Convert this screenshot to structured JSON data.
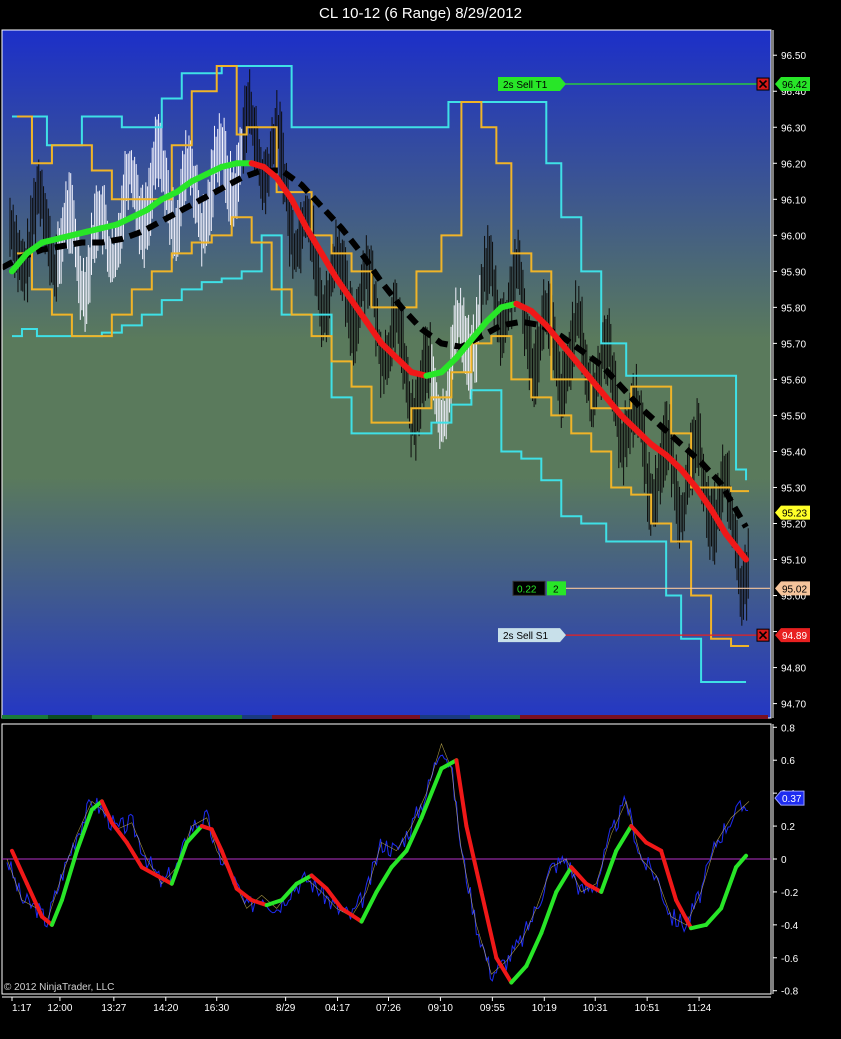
{
  "window": {
    "title": "CL 10-12 (6 Range)  8/29/2012"
  },
  "copyright": "© 2012 NinjaTrader, LLC",
  "colors": {
    "bg_top": "#1c2fc9",
    "bg_mid": "#5a7a5c",
    "bg_bottom": "#2437c4",
    "frame": "#ffffff",
    "cyan_band": "#3fe0e6",
    "orange_band": "#f0b428",
    "trend_up": "#28e628",
    "trend_down": "#f01818",
    "baseline": "#000000",
    "osc_fast": "#1e2cf0",
    "osc_zero": "#b432c8"
  },
  "chart_data": [
    {
      "type": "line",
      "panel": "price",
      "y_ticks": [
        "96.50",
        "96.40",
        "96.30",
        "96.20",
        "96.10",
        "96.00",
        "95.90",
        "95.80",
        "95.70",
        "95.60",
        "95.50",
        "95.40",
        "95.30",
        "95.20",
        "95.10",
        "95.00",
        "94.90",
        "94.80",
        "94.70"
      ],
      "ylim": [
        94.66,
        96.57
      ],
      "x_range": [
        0,
        770
      ],
      "price_markers": [
        {
          "label": "96.42",
          "value": 96.42,
          "color": "#28e628",
          "text_color": "#000000"
        },
        {
          "label": "95.23",
          "value": 95.23,
          "color": "#ffff28",
          "text_color": "#000000"
        },
        {
          "label": "95.02",
          "value": 95.02,
          "color": "#f5c49b",
          "text_color": "#000000"
        },
        {
          "label": "94.89",
          "value": 94.89,
          "color": "#e82020",
          "text_color": "#ffffff"
        }
      ],
      "order_lines": [
        {
          "label": "2s   Sell T1",
          "value": 96.42,
          "color": "#28e628",
          "text_color": "#000000"
        },
        {
          "label": "2s   Sell S1",
          "value": 94.89,
          "color": "#c8e0ea",
          "text_color": "#000000",
          "line_color": "#e82020"
        }
      ],
      "position": {
        "pnl": "0.22",
        "qty": "2",
        "value": 95.02
      },
      "series": [
        {
          "name": "",
          "role": "trend",
          "width": 6,
          "color_switch": true,
          "x": [
            10,
            25,
            40,
            55,
            70,
            85,
            100,
            115,
            130,
            145,
            160,
            175,
            190,
            205,
            220,
            235,
            250,
            262,
            275,
            290,
            305,
            320,
            335,
            350,
            365,
            380,
            395,
            410,
            425,
            440,
            455,
            470,
            485,
            500,
            515,
            530,
            545,
            560,
            575,
            590,
            605,
            620,
            635,
            650,
            665,
            680,
            695,
            710,
            725,
            745
          ],
          "y": [
            95.9,
            95.95,
            95.98,
            95.99,
            96.0,
            96.01,
            96.02,
            96.03,
            96.05,
            96.07,
            96.1,
            96.12,
            96.15,
            96.17,
            96.19,
            96.2,
            96.2,
            96.19,
            96.16,
            96.1,
            96.02,
            95.95,
            95.88,
            95.82,
            95.76,
            95.7,
            95.66,
            95.62,
            95.61,
            95.62,
            95.66,
            95.71,
            95.76,
            95.8,
            95.81,
            95.79,
            95.75,
            95.7,
            95.65,
            95.6,
            95.55,
            95.5,
            95.46,
            95.42,
            95.39,
            95.35,
            95.3,
            95.24,
            95.17,
            95.1
          ]
        },
        {
          "name": "",
          "role": "baseline",
          "width": 6,
          "dash": "12,7",
          "x": [
            0,
            20,
            40,
            60,
            80,
            100,
            120,
            140,
            160,
            180,
            200,
            220,
            240,
            260,
            280,
            300,
            320,
            340,
            360,
            380,
            400,
            420,
            440,
            460,
            480,
            500,
            520,
            540,
            560,
            580,
            600,
            620,
            640,
            660,
            680,
            700,
            720,
            745
          ],
          "y": [
            95.91,
            95.94,
            95.96,
            95.97,
            95.98,
            95.98,
            95.99,
            96.01,
            96.04,
            96.07,
            96.1,
            96.13,
            96.16,
            96.18,
            96.18,
            96.14,
            96.08,
            96.02,
            95.95,
            95.87,
            95.8,
            95.74,
            95.7,
            95.69,
            95.72,
            95.75,
            95.76,
            95.75,
            95.72,
            95.68,
            95.64,
            95.58,
            95.52,
            95.47,
            95.42,
            95.37,
            95.31,
            95.19
          ]
        },
        {
          "name": "",
          "role": "cyan_upper",
          "width": 2,
          "step": true,
          "x": [
            10,
            30,
            45,
            60,
            80,
            100,
            120,
            140,
            160,
            180,
            200,
            220,
            240,
            260,
            290,
            310,
            330,
            360,
            390,
            420,
            447,
            470,
            490,
            510,
            530,
            545,
            560,
            580,
            600,
            625,
            650,
            670,
            690,
            712,
            735,
            745
          ],
          "y": [
            96.33,
            96.33,
            96.25,
            96.25,
            96.33,
            96.33,
            96.3,
            96.3,
            96.38,
            96.45,
            96.45,
            96.47,
            96.47,
            96.47,
            96.3,
            96.3,
            96.3,
            96.3,
            96.3,
            96.3,
            96.37,
            96.37,
            96.37,
            96.37,
            96.37,
            96.2,
            96.05,
            95.9,
            95.7,
            95.61,
            95.61,
            95.61,
            95.61,
            95.61,
            95.35,
            95.32
          ]
        },
        {
          "name": "",
          "role": "cyan_lower",
          "width": 2,
          "step": true,
          "x": [
            10,
            20,
            35,
            60,
            80,
            100,
            120,
            140,
            160,
            180,
            200,
            220,
            240,
            260,
            280,
            300,
            330,
            350,
            370,
            390,
            410,
            430,
            450,
            470,
            490,
            500,
            520,
            540,
            560,
            580,
            605,
            640,
            665,
            680,
            700,
            720,
            745
          ],
          "y": [
            95.72,
            95.74,
            95.72,
            95.72,
            95.72,
            95.73,
            95.75,
            95.78,
            95.82,
            95.85,
            95.87,
            95.88,
            95.9,
            96.0,
            95.78,
            95.78,
            95.55,
            95.45,
            95.45,
            95.45,
            95.45,
            95.48,
            95.53,
            95.57,
            95.57,
            95.4,
            95.38,
            95.32,
            95.22,
            95.2,
            95.15,
            95.15,
            95.0,
            94.88,
            94.76,
            94.76,
            94.76
          ]
        },
        {
          "name": "",
          "role": "orange_upper",
          "width": 2,
          "step": true,
          "x": [
            15,
            30,
            50,
            70,
            90,
            110,
            130,
            150,
            170,
            190,
            215,
            235,
            245,
            275,
            290,
            310,
            330,
            350,
            370,
            390,
            415,
            440,
            460,
            480,
            495,
            510,
            530,
            550,
            570,
            590,
            610,
            630,
            650,
            670,
            690,
            710,
            730,
            748
          ],
          "y": [
            96.33,
            96.2,
            96.25,
            96.25,
            96.18,
            96.1,
            96.1,
            96.1,
            96.25,
            96.4,
            96.47,
            96.28,
            96.3,
            96.12,
            96.12,
            96.0,
            95.95,
            95.9,
            95.8,
            95.8,
            95.9,
            96.0,
            96.37,
            96.3,
            96.2,
            95.95,
            95.9,
            95.6,
            95.6,
            95.52,
            95.52,
            95.58,
            95.58,
            95.45,
            95.3,
            95.3,
            95.29,
            95.29
          ]
        },
        {
          "name": "",
          "role": "orange_lower",
          "width": 2,
          "step": true,
          "x": [
            15,
            30,
            50,
            70,
            90,
            110,
            130,
            150,
            170,
            190,
            210,
            230,
            250,
            270,
            290,
            310,
            330,
            350,
            370,
            390,
            410,
            430,
            450,
            470,
            490,
            510,
            530,
            550,
            570,
            590,
            610,
            630,
            650,
            670,
            690,
            710,
            730,
            748
          ],
          "y": [
            95.95,
            95.85,
            95.78,
            95.72,
            95.72,
            95.78,
            95.85,
            95.9,
            95.95,
            95.98,
            96.0,
            96.05,
            95.98,
            95.85,
            95.78,
            95.72,
            95.65,
            95.58,
            95.48,
            95.48,
            95.52,
            95.55,
            95.62,
            95.7,
            95.72,
            95.6,
            95.55,
            95.5,
            95.45,
            95.4,
            95.3,
            95.28,
            95.2,
            95.15,
            95.0,
            94.88,
            94.86,
            94.86
          ]
        }
      ]
    },
    {
      "type": "line",
      "panel": "oscillator",
      "y_ticks": [
        "0.8",
        "0.6",
        "0.4",
        "0.2",
        "0",
        "-0.2",
        "-0.4",
        "-0.6",
        "-0.8"
      ],
      "ylim": [
        -0.82,
        0.82
      ],
      "position_marker": {
        "label": "0.37",
        "value": 0.37,
        "color": "#1e2cf0"
      },
      "series": [
        {
          "name": "",
          "role": "signal",
          "width": 4,
          "color_switch": true,
          "x": [
            10,
            25,
            40,
            50,
            60,
            75,
            90,
            100,
            110,
            125,
            140,
            155,
            170,
            185,
            200,
            210,
            220,
            235,
            250,
            265,
            280,
            295,
            310,
            325,
            340,
            360,
            375,
            390,
            405,
            420,
            440,
            455,
            465,
            480,
            495,
            510,
            525,
            540,
            555,
            570,
            585,
            600,
            615,
            630,
            645,
            660,
            675,
            690,
            705,
            720,
            735,
            745
          ],
          "y": [
            0.05,
            -0.15,
            -0.35,
            -0.4,
            -0.25,
            0.05,
            0.3,
            0.35,
            0.22,
            0.1,
            -0.05,
            -0.1,
            -0.15,
            0.1,
            0.2,
            0.18,
            0.05,
            -0.18,
            -0.25,
            -0.28,
            -0.25,
            -0.15,
            -0.1,
            -0.18,
            -0.3,
            -0.38,
            -0.2,
            -0.05,
            0.05,
            0.25,
            0.55,
            0.6,
            0.2,
            -0.2,
            -0.6,
            -0.75,
            -0.65,
            -0.45,
            -0.2,
            -0.05,
            -0.15,
            -0.2,
            0.05,
            0.2,
            0.1,
            0.05,
            -0.25,
            -0.42,
            -0.4,
            -0.3,
            -0.05,
            0.02
          ]
        },
        {
          "name": "",
          "role": "fast",
          "width": 1,
          "x": [
            5,
            20,
            35,
            45,
            60,
            75,
            90,
            100,
            115,
            130,
            145,
            160,
            175,
            190,
            205,
            215,
            230,
            245,
            260,
            275,
            290,
            305,
            320,
            335,
            350,
            365,
            380,
            395,
            410,
            425,
            440,
            450,
            460,
            475,
            490,
            505,
            520,
            535,
            550,
            565,
            580,
            595,
            610,
            625,
            640,
            655,
            670,
            685,
            700,
            715,
            730,
            748
          ],
          "y": [
            0.0,
            -0.25,
            -0.3,
            -0.38,
            -0.1,
            0.15,
            0.35,
            0.3,
            0.18,
            0.22,
            0.0,
            -0.15,
            -0.05,
            0.2,
            0.25,
            0.05,
            -0.1,
            -0.3,
            -0.22,
            -0.3,
            -0.18,
            -0.12,
            -0.2,
            -0.3,
            -0.35,
            -0.2,
            0.1,
            0.05,
            0.2,
            0.4,
            0.7,
            0.55,
            0.05,
            -0.4,
            -0.7,
            -0.62,
            -0.5,
            -0.3,
            -0.05,
            0.0,
            -0.2,
            -0.15,
            0.15,
            0.35,
            0.0,
            -0.1,
            -0.35,
            -0.4,
            -0.2,
            0.1,
            0.25,
            0.35
          ]
        },
        {
          "name": "",
          "role": "zero",
          "width": 1,
          "x": [
            0,
            770
          ],
          "y": [
            0,
            0
          ]
        }
      ]
    }
  ],
  "x_axis": {
    "ticks": [
      {
        "label": "1:17",
        "pos": 10
      },
      {
        "label": "12:00",
        "pos": 58
      },
      {
        "label": "13:27",
        "pos": 112
      },
      {
        "label": "14:20",
        "pos": 164
      },
      {
        "label": "16:30",
        "pos": 215
      },
      {
        "label": "8/29",
        "pos": 284
      },
      {
        "label": "04:17",
        "pos": 336
      },
      {
        "label": "07:26",
        "pos": 387
      },
      {
        "label": "09:10",
        "pos": 439
      },
      {
        "label": "09:55",
        "pos": 491
      },
      {
        "label": "10:19",
        "pos": 543
      },
      {
        "label": "10:31",
        "pos": 594
      },
      {
        "label": "10:51",
        "pos": 646
      },
      {
        "label": "11:24",
        "pos": 698
      }
    ]
  }
}
